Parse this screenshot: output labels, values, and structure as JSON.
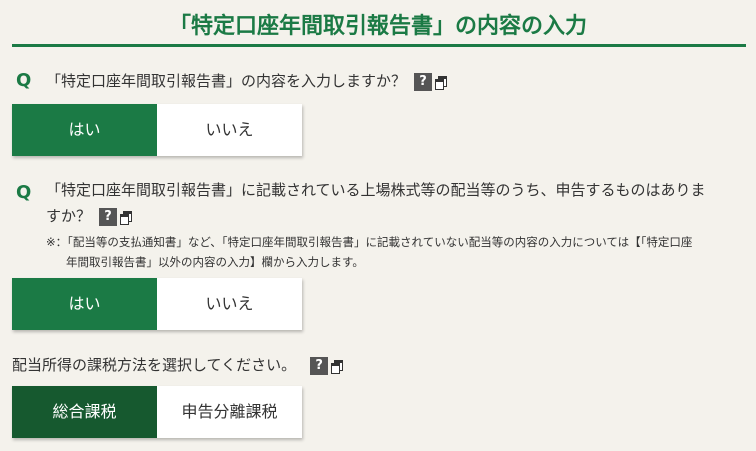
{
  "page": {
    "title": "「特定口座年間取引報告書」の内容の入力"
  },
  "q1": {
    "marker": "Q",
    "text": "「特定口座年間取引報告書」の内容を入力しますか？",
    "help_label": "?",
    "options": {
      "yes": "はい",
      "no": "いいえ"
    },
    "selected": "はい"
  },
  "q2": {
    "marker": "Q",
    "text_line1": "「特定口座年間取引報告書」に記載されている上場株式等の配当等のうち、申告するものはありま",
    "text_line2": "すか？",
    "help_label": "?",
    "note_line1": "※：「配当等の支払通知書」など、「特定口座年間取引報告書」に記載されていない配当等の内容の入力については【「特定口座",
    "note_line2": "年間取引報告書」以外の内容の入力】欄から入力します。",
    "options": {
      "yes": "はい",
      "no": "いいえ"
    },
    "selected": "はい"
  },
  "q3": {
    "text": "配当所得の課税方法を選択してください。",
    "help_label": "?",
    "options": {
      "comprehensive": "総合課税",
      "separate": "申告分離課税"
    },
    "selected": "総合課税"
  },
  "colors": {
    "accent_green": "#1b7a45",
    "selected_dark_green": "#16592f",
    "background": "#f4f2ec"
  }
}
